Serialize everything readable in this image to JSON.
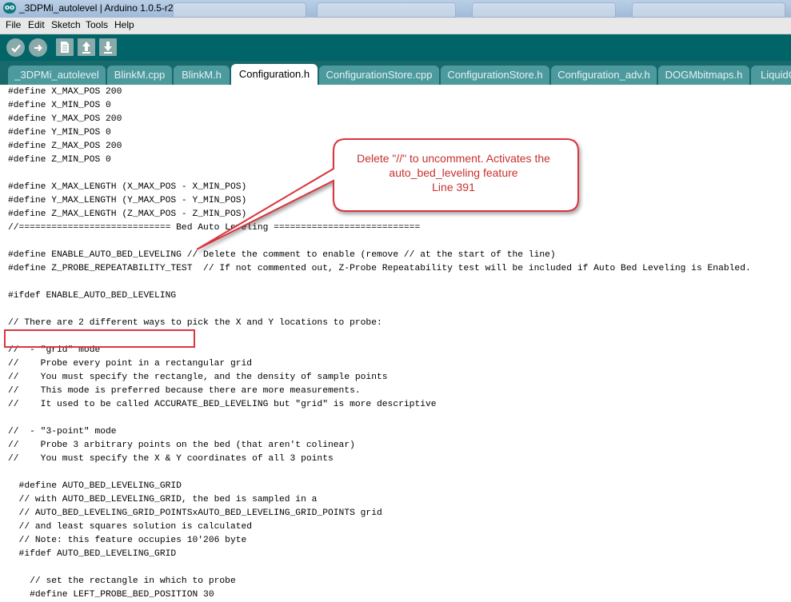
{
  "window": {
    "title": "_3DPMi_autolevel | Arduino 1.0.5-r2",
    "logo_text": "oo"
  },
  "menu": [
    "File",
    "Edit",
    "Sketch",
    "Tools",
    "Help"
  ],
  "toolbar": {
    "buttons": [
      "verify-icon",
      "upload-icon",
      "new-icon",
      "open-icon",
      "save-icon"
    ]
  },
  "tabs": [
    {
      "label": "_3DPMi_autolevel",
      "active": false
    },
    {
      "label": "BlinkM.cpp",
      "active": false
    },
    {
      "label": "BlinkM.h",
      "active": false
    },
    {
      "label": "Configuration.h",
      "active": true
    },
    {
      "label": "ConfigurationStore.cpp",
      "active": false
    },
    {
      "label": "ConfigurationStore.h",
      "active": false
    },
    {
      "label": "Configuration_adv.h",
      "active": false
    },
    {
      "label": "DOGMbitmaps.h",
      "active": false
    },
    {
      "label": "LiquidC",
      "active": false
    }
  ],
  "code_lines": [
    "#define X_MAX_POS 200",
    "#define X_MIN_POS 0",
    "#define Y_MAX_POS 200",
    "#define Y_MIN_POS 0",
    "#define Z_MAX_POS 200",
    "#define Z_MIN_POS 0",
    "",
    "#define X_MAX_LENGTH (X_MAX_POS - X_MIN_POS)",
    "#define Y_MAX_LENGTH (Y_MAX_POS - Y_MIN_POS)",
    "#define Z_MAX_LENGTH (Z_MAX_POS - Z_MIN_POS)",
    "//============================ Bed Auto Leveling ===========================",
    "",
    "#define ENABLE_AUTO_BED_LEVELING // Delete the comment to enable (remove // at the start of the line)",
    "#define Z_PROBE_REPEATABILITY_TEST  // If not commented out, Z-Probe Repeatability test will be included if Auto Bed Leveling is Enabled.",
    "",
    "#ifdef ENABLE_AUTO_BED_LEVELING",
    "",
    "// There are 2 different ways to pick the X and Y locations to probe:",
    "",
    "//  - \"grid\" mode",
    "//    Probe every point in a rectangular grid",
    "//    You must specify the rectangle, and the density of sample points",
    "//    This mode is preferred because there are more measurements.",
    "//    It used to be called ACCURATE_BED_LEVELING but \"grid\" is more descriptive",
    "",
    "//  - \"3-point\" mode",
    "//    Probe 3 arbitrary points on the bed (that aren't colinear)",
    "//    You must specify the X & Y coordinates of all 3 points",
    "",
    "  #define AUTO_BED_LEVELING_GRID",
    "  // with AUTO_BED_LEVELING_GRID, the bed is sampled in a",
    "  // AUTO_BED_LEVELING_GRID_POINTSxAUTO_BED_LEVELING_GRID_POINTS grid",
    "  // and least squares solution is calculated",
    "  // Note: this feature occupies 10'206 byte",
    "  #ifdef AUTO_BED_LEVELING_GRID",
    "",
    "    // set the rectangle in which to probe",
    "    #define LEFT_PROBE_BED_POSITION 30"
  ],
  "annotation": {
    "lines": [
      "Delete \"//\" to uncomment. Activates the",
      "auto_bed_leveling feature",
      "Line 391"
    ],
    "color": "#d9363e"
  }
}
